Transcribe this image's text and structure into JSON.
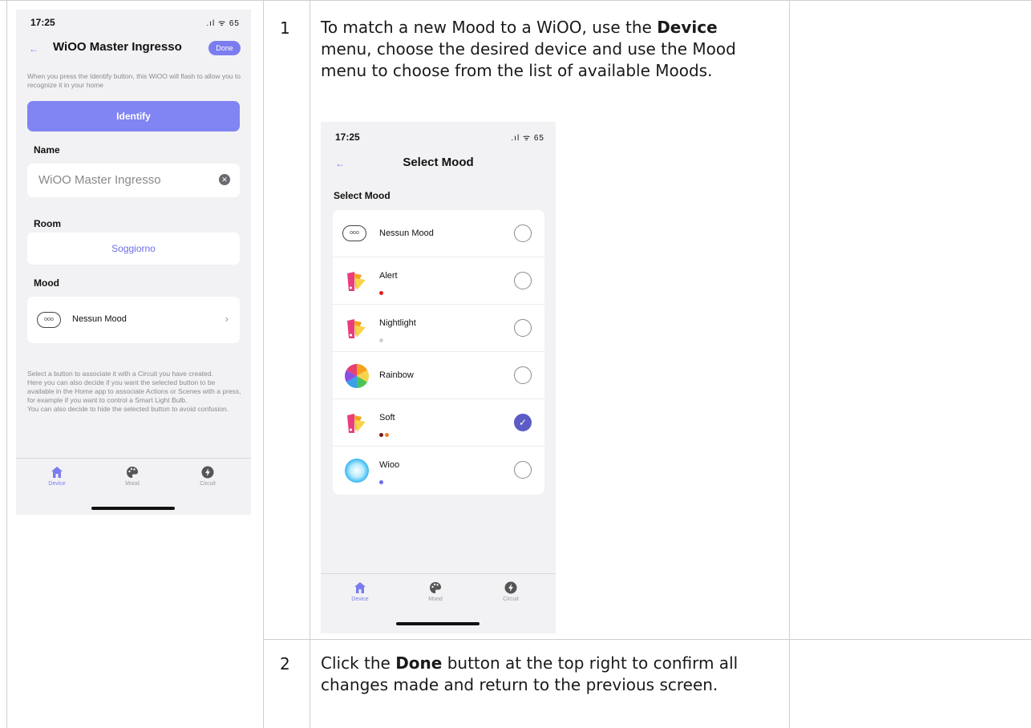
{
  "steps": [
    {
      "number": "1",
      "text_parts": [
        "To match a new Mood to a WiOO, use the ",
        "Device",
        " menu, choose the desired device and use the Mood menu to choose from the list of available Moods."
      ]
    },
    {
      "number": "2",
      "text_parts": [
        "Click the ",
        "Done",
        " button at the top right to confirm all changes made and return to the previous screen."
      ]
    }
  ],
  "phone1": {
    "time": "17:25",
    "status": ".ıl ᯤ 65",
    "title": "WiOO Master Ingresso",
    "done_label": "Done",
    "identify_hint": "When you press the Identify button, this WiOO will flash to allow you to recognize it in your home",
    "identify_label": "Identify",
    "name_label": "Name",
    "name_value": "WiOO Master Ingresso",
    "room_label": "Room",
    "room_value": "Soggiorno",
    "mood_label": "Mood",
    "mood_value": "Nessun Mood",
    "footer_text": "Select a button to associate it with a Circuit you have created.\nHere you can also decide if you want the selected button to be available in the Home app to associate Actions or Scenes with a press, for example if you want to control a Smart Light Bulb.\nYou can also decide to hide the selected button to avoid confusion.",
    "tabs": [
      {
        "label": "Device",
        "icon": "home-icon",
        "active": true
      },
      {
        "label": "Mood",
        "icon": "palette-icon",
        "active": false
      },
      {
        "label": "Circuit",
        "icon": "lightning-icon",
        "active": false
      }
    ]
  },
  "phone2": {
    "time": "17:25",
    "status": ".ıl ᯤ 65",
    "title": "Select Mood",
    "section_label": "Select Mood",
    "moods": [
      {
        "name": "Nessun Mood",
        "icon": "none-mood-icon",
        "selected": false,
        "dots": []
      },
      {
        "name": "Alert",
        "icon": "palette-icon",
        "selected": false,
        "dots": [
          "#e02020"
        ]
      },
      {
        "name": "Nightlight",
        "icon": "palette-icon",
        "selected": false,
        "dots": [
          "#d0d0d0"
        ]
      },
      {
        "name": "Rainbow",
        "icon": "rainbow-icon",
        "selected": false,
        "dots": []
      },
      {
        "name": "Soft",
        "icon": "palette-icon",
        "selected": true,
        "dots": [
          "#7a1a1a",
          "#f08020"
        ]
      },
      {
        "name": "Wioo",
        "icon": "wioo-glow-icon",
        "selected": false,
        "dots": [
          "#6a6cf0"
        ]
      }
    ],
    "tabs": [
      {
        "label": "Device",
        "icon": "home-icon",
        "active": true
      },
      {
        "label": "Mood",
        "icon": "palette-icon",
        "active": false
      },
      {
        "label": "Circuit",
        "icon": "lightning-icon",
        "active": false
      }
    ]
  },
  "colors": {
    "accent": "#7b7cf0",
    "selected": "#5b5cc6",
    "grid": "#cfcfcf"
  }
}
